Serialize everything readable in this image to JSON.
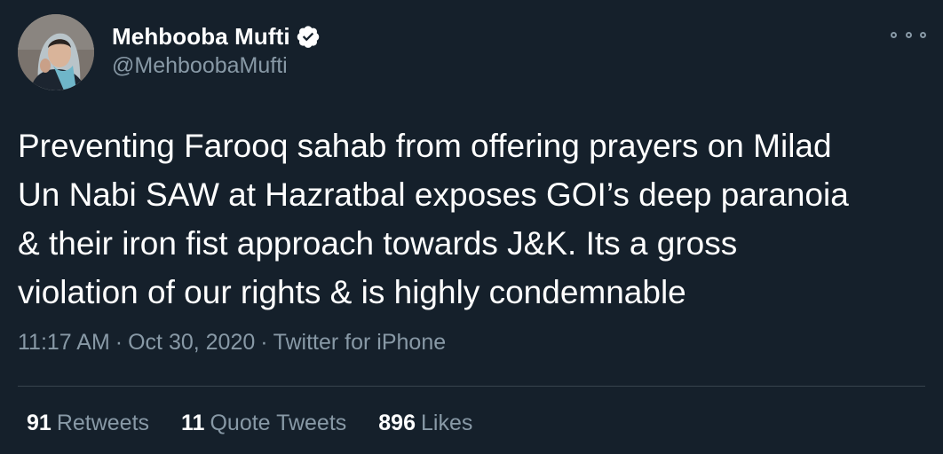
{
  "author": {
    "display_name": "Mehbooba Mufti",
    "handle": "@MehboobaMufti",
    "verified": true
  },
  "tweet": {
    "text": "Preventing Farooq sahab from offering prayers on Milad\nUn Nabi SAW at Hazratbal exposes GOI’s deep paranoia\n& their iron fist approach towards J&K. Its a gross\nviolation of our rights & is highly condemnable",
    "time": "11:17 AM",
    "date": "Oct 30, 2020",
    "source": "Twitter for iPhone",
    "separator": "·"
  },
  "stats": {
    "retweets": {
      "count": "91",
      "label": "Retweets"
    },
    "quote_tweets": {
      "count": "11",
      "label": "Quote Tweets"
    },
    "likes": {
      "count": "896",
      "label": "Likes"
    }
  },
  "icons": {
    "more": "more-options-icon",
    "verified": "verified-badge-icon"
  },
  "colors": {
    "background": "#15202b",
    "primary_text": "#ffffff",
    "secondary_text": "#8899a6",
    "divider": "#38444d",
    "verified_badge": "#ffffff"
  }
}
